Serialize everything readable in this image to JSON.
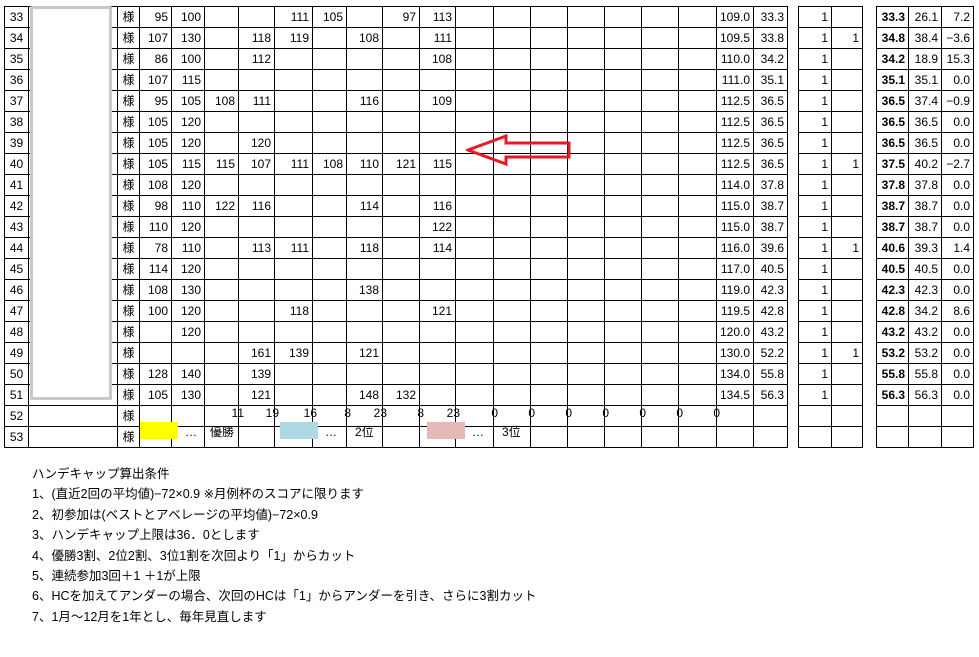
{
  "rows": [
    {
      "no": "33",
      "sama": "様",
      "a": "95",
      "b": "100",
      "s1": "",
      "s2": "",
      "s3": "111",
      "s4": "105",
      "s5": "",
      "s6": "97",
      "s7": "113",
      "v1": "109.0",
      "v2": "33.3",
      "p": "1",
      "w": "",
      "h1": "33.3",
      "h2": "26.1",
      "h3": "7.2"
    },
    {
      "no": "34",
      "sama": "様",
      "a": "107",
      "b": "130",
      "s1": "",
      "s2": "118",
      "s3": "119",
      "s4": "",
      "s5": "108",
      "s6": "",
      "s7": "111",
      "v1": "109.5",
      "v2": "33.8",
      "p": "1",
      "w": "1",
      "h1": "34.8",
      "h2": "38.4",
      "h3": "−3.6"
    },
    {
      "no": "35",
      "sama": "様",
      "a": "86",
      "b": "100",
      "s1": "",
      "s2": "112",
      "s3": "",
      "s4": "",
      "s5": "",
      "s6": "",
      "s7": "108",
      "v1": "110.0",
      "v2": "34.2",
      "p": "1",
      "w": "",
      "h1": "34.2",
      "h2": "18.9",
      "h3": "15.3"
    },
    {
      "no": "36",
      "sama": "様",
      "a": "107",
      "b": "115",
      "s1": "",
      "s2": "",
      "s3": "",
      "s4": "",
      "s5": "",
      "s6": "",
      "s7": "",
      "v1": "111.0",
      "v2": "35.1",
      "p": "1",
      "w": "",
      "h1": "35.1",
      "h2": "35.1",
      "h3": "0.0"
    },
    {
      "no": "37",
      "sama": "様",
      "a": "95",
      "b": "105",
      "s1": "108",
      "s2": "111",
      "s3": "",
      "s4": "",
      "s5": "116",
      "s6": "",
      "s7": "109",
      "v1": "112.5",
      "v2": "36.5",
      "p": "1",
      "w": "",
      "h1": "36.5",
      "h2": "37.4",
      "h3": "−0.9"
    },
    {
      "no": "38",
      "sama": "様",
      "a": "105",
      "b": "120",
      "s1": "",
      "s2": "",
      "s3": "",
      "s4": "",
      "s5": "",
      "s6": "",
      "s7": "",
      "v1": "112.5",
      "v2": "36.5",
      "p": "1",
      "w": "",
      "h1": "36.5",
      "h2": "36.5",
      "h3": "0.0"
    },
    {
      "no": "39",
      "sama": "様",
      "a": "105",
      "b": "120",
      "s1": "",
      "s2": "120",
      "s3": "",
      "s4": "",
      "s5": "",
      "s6": "",
      "s7": "",
      "v1": "112.5",
      "v2": "36.5",
      "p": "1",
      "w": "",
      "h1": "36.5",
      "h2": "36.5",
      "h3": "0.0"
    },
    {
      "no": "40",
      "sama": "様",
      "a": "105",
      "b": "115",
      "s1": "115",
      "s2": "107",
      "s3": "111",
      "s4": "108",
      "s5": "110",
      "s6": "121",
      "s7": "115",
      "v1": "112.5",
      "v2": "36.5",
      "p": "1",
      "w": "1",
      "h1": "37.5",
      "h2": "40.2",
      "h3": "−2.7"
    },
    {
      "no": "41",
      "sama": "様",
      "a": "108",
      "b": "120",
      "s1": "",
      "s2": "",
      "s3": "",
      "s4": "",
      "s5": "",
      "s6": "",
      "s7": "",
      "v1": "114.0",
      "v2": "37.8",
      "p": "1",
      "w": "",
      "h1": "37.8",
      "h2": "37.8",
      "h3": "0.0"
    },
    {
      "no": "42",
      "sama": "様",
      "a": "98",
      "b": "110",
      "s1": "122",
      "s2": "116",
      "s3": "",
      "s4": "",
      "s5": "114",
      "s6": "",
      "s7": "116",
      "v1": "115.0",
      "v2": "38.7",
      "p": "1",
      "w": "",
      "h1": "38.7",
      "h2": "38.7",
      "h3": "0.0"
    },
    {
      "no": "43",
      "sama": "様",
      "a": "110",
      "b": "120",
      "s1": "",
      "s2": "",
      "s3": "",
      "s4": "",
      "s5": "",
      "s6": "",
      "s7": "122",
      "v1": "115.0",
      "v2": "38.7",
      "p": "1",
      "w": "",
      "h1": "38.7",
      "h2": "38.7",
      "h3": "0.0"
    },
    {
      "no": "44",
      "sama": "様",
      "a": "78",
      "b": "110",
      "s1": "",
      "s2": "113",
      "s3": "111",
      "s4": "",
      "s5": "118",
      "s6": "",
      "s7": "114",
      "v1": "116.0",
      "v2": "39.6",
      "p": "1",
      "w": "1",
      "h1": "40.6",
      "h2": "39.3",
      "h3": "1.4"
    },
    {
      "no": "45",
      "sama": "様",
      "a": "114",
      "b": "120",
      "s1": "",
      "s2": "",
      "s3": "",
      "s4": "",
      "s5": "",
      "s6": "",
      "s7": "",
      "v1": "117.0",
      "v2": "40.5",
      "p": "1",
      "w": "",
      "h1": "40.5",
      "h2": "40.5",
      "h3": "0.0"
    },
    {
      "no": "46",
      "sama": "様",
      "a": "108",
      "b": "130",
      "s1": "",
      "s2": "",
      "s3": "",
      "s4": "",
      "s5": "138",
      "s6": "",
      "s7": "",
      "v1": "119.0",
      "v2": "42.3",
      "p": "1",
      "w": "",
      "h1": "42.3",
      "h2": "42.3",
      "h3": "0.0"
    },
    {
      "no": "47",
      "sama": "様",
      "a": "100",
      "b": "120",
      "s1": "",
      "s2": "",
      "s3": "118",
      "s4": "",
      "s5": "",
      "s6": "",
      "s7": "121",
      "v1": "119.5",
      "v2": "42.8",
      "p": "1",
      "w": "",
      "h1": "42.8",
      "h2": "34.2",
      "h3": "8.6"
    },
    {
      "no": "48",
      "sama": "様",
      "a": "",
      "b": "120",
      "s1": "",
      "s2": "",
      "s3": "",
      "s4": "",
      "s5": "",
      "s6": "",
      "s7": "",
      "v1": "120.0",
      "v2": "43.2",
      "p": "1",
      "w": "",
      "h1": "43.2",
      "h2": "43.2",
      "h3": "0.0"
    },
    {
      "no": "49",
      "sama": "様",
      "a": "",
      "b": "",
      "s1": "",
      "s2": "161",
      "s3": "139",
      "s4": "",
      "s5": "121",
      "s6": "",
      "s7": "",
      "v1": "130.0",
      "v2": "52.2",
      "p": "1",
      "w": "1",
      "h1": "53.2",
      "h2": "53.2",
      "h3": "0.0"
    },
    {
      "no": "50",
      "sama": "様",
      "a": "128",
      "b": "140",
      "s1": "",
      "s2": "139",
      "s3": "",
      "s4": "",
      "s5": "",
      "s6": "",
      "s7": "",
      "v1": "134.0",
      "v2": "55.8",
      "p": "1",
      "w": "",
      "h1": "55.8",
      "h2": "55.8",
      "h3": "0.0"
    },
    {
      "no": "51",
      "sama": "様",
      "a": "105",
      "b": "130",
      "s1": "",
      "s2": "121",
      "s3": "",
      "s4": "",
      "s5": "148",
      "s6": "132",
      "s7": "",
      "v1": "134.5",
      "v2": "56.3",
      "p": "1",
      "w": "",
      "h1": "56.3",
      "h2": "56.3",
      "h3": "0.0"
    },
    {
      "no": "52",
      "sama": "様",
      "a": "",
      "b": "",
      "s1": "",
      "s2": "",
      "s3": "",
      "s4": "",
      "s5": "",
      "s6": "",
      "s7": "",
      "v1": "",
      "v2": "",
      "p": "",
      "w": "",
      "h1": "",
      "h2": "",
      "h3": ""
    },
    {
      "no": "53",
      "sama": "様",
      "a": "",
      "b": "",
      "s1": "",
      "s2": "",
      "s3": "",
      "s4": "",
      "s5": "",
      "s6": "",
      "s7": "",
      "v1": "",
      "v2": "",
      "p": "",
      "w": "",
      "h1": "",
      "h2": "",
      "h3": ""
    }
  ],
  "totals": [
    "11",
    "19",
    "16",
    "8",
    "23",
    "8",
    "23",
    "0",
    "0",
    "0",
    "0",
    "0",
    "0",
    "0"
  ],
  "legend": [
    {
      "label": "優勝",
      "color": "#ffff00"
    },
    {
      "label": "2位",
      "color": "#add8e6"
    },
    {
      "label": "3位",
      "color": "#e6b8b7"
    }
  ],
  "legend_dots": "…",
  "arrow_color": "#e31b23",
  "notes": [
    "ハンデキャップ算出条件",
    "1、(直近2回の平均値)−72×0.9 ※月例杯のスコアに限ります",
    "2、初参加は(ベストとアベレージの平均値)−72×0.9",
    "3、ハンデキャップ上限は36．0とします",
    "4、優勝3割、2位2割、3位1割を次回より「1」からカット",
    "5、連続参加3回＋1 ＋1が上限",
    "6、HCを加えてアンダーの場合、次回のHCは「1」からアンダーを引き、さらに3割カット",
    "7、1月〜12月を1年とし、毎年見直します"
  ]
}
